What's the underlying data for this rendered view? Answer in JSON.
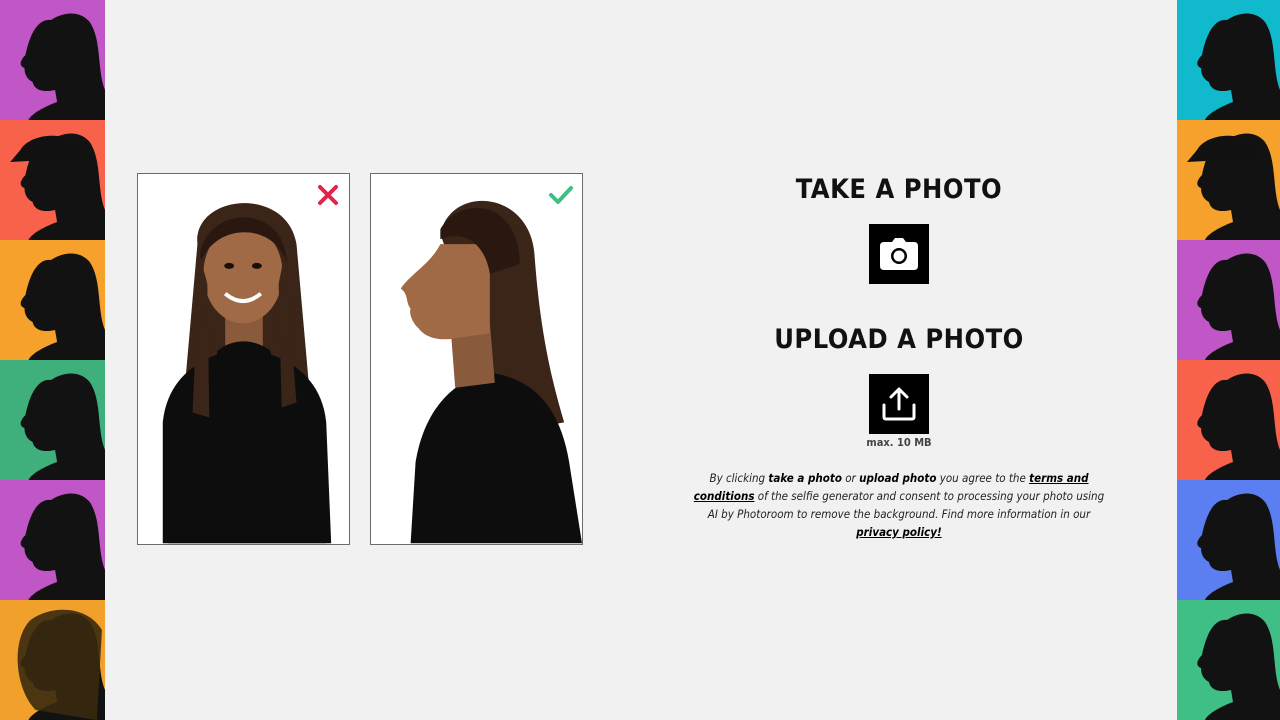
{
  "left_strip": {
    "tiles": [
      {
        "color": "#c156c6",
        "icon": "profile-silhouette-icon"
      },
      {
        "color": "#f8624a",
        "icon": "profile-silhouette-cap-icon"
      },
      {
        "color": "#f5a12c",
        "icon": "profile-silhouette-icon"
      },
      {
        "color": "#3faf7c",
        "icon": "profile-silhouette-icon"
      },
      {
        "color": "#c156c6",
        "icon": "profile-silhouette-icon"
      },
      {
        "color": "#f0a02b",
        "icon": "profile-silhouette-curly-icon"
      }
    ]
  },
  "right_strip": {
    "tiles": [
      {
        "color": "#11b9cc",
        "icon": "profile-silhouette-icon"
      },
      {
        "color": "#f5a12c",
        "icon": "profile-silhouette-cap-icon"
      },
      {
        "color": "#c156c6",
        "icon": "profile-silhouette-icon"
      },
      {
        "color": "#f8624a",
        "icon": "profile-silhouette-icon"
      },
      {
        "color": "#5b7ff0",
        "icon": "profile-silhouette-icon"
      },
      {
        "color": "#3fbf86",
        "icon": "profile-silhouette-icon"
      }
    ]
  },
  "examples": {
    "bad": {
      "mark_icon": "x-mark-icon",
      "mark_color": "#e0244a"
    },
    "good": {
      "mark_icon": "check-mark-icon",
      "mark_color": "#3fbf86"
    }
  },
  "take_photo": {
    "heading": "TAKE A PHOTO",
    "icon": "camera-icon"
  },
  "upload_photo": {
    "heading": "UPLOAD A PHOTO",
    "icon": "upload-icon",
    "max_size": "max. 10 MB"
  },
  "consent": {
    "t1": "By clicking ",
    "b1": "take a photo",
    "t2": " or ",
    "b2": "upload photo",
    "t3": " you agree to the ",
    "link_terms": "terms and conditions",
    "t4": " of the selfie generator and consent to processing your photo using AI by Photoroom to remove the background. Find more information in our ",
    "link_privacy": "privacy policy!"
  }
}
